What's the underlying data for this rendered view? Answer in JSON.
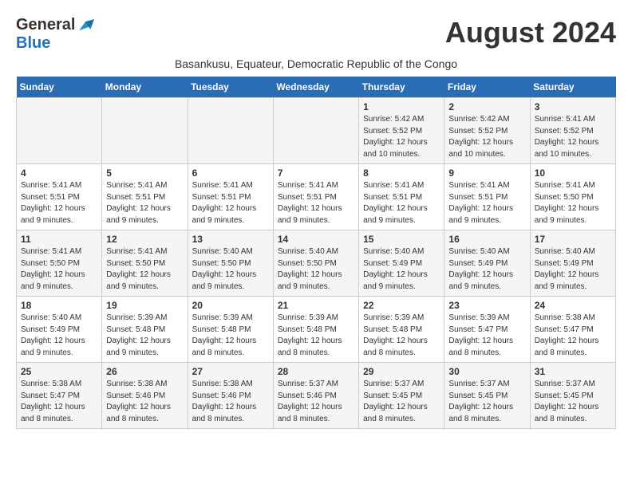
{
  "header": {
    "logo": {
      "general": "General",
      "blue": "Blue"
    },
    "title": "August 2024",
    "subtitle": "Basankusu, Equateur, Democratic Republic of the Congo"
  },
  "calendar": {
    "weekdays": [
      "Sunday",
      "Monday",
      "Tuesday",
      "Wednesday",
      "Thursday",
      "Friday",
      "Saturday"
    ],
    "weeks": [
      [
        {
          "day": "",
          "info": ""
        },
        {
          "day": "",
          "info": ""
        },
        {
          "day": "",
          "info": ""
        },
        {
          "day": "",
          "info": ""
        },
        {
          "day": "1",
          "info": "Sunrise: 5:42 AM\nSunset: 5:52 PM\nDaylight: 12 hours\nand 10 minutes."
        },
        {
          "day": "2",
          "info": "Sunrise: 5:42 AM\nSunset: 5:52 PM\nDaylight: 12 hours\nand 10 minutes."
        },
        {
          "day": "3",
          "info": "Sunrise: 5:41 AM\nSunset: 5:52 PM\nDaylight: 12 hours\nand 10 minutes."
        }
      ],
      [
        {
          "day": "4",
          "info": "Sunrise: 5:41 AM\nSunset: 5:51 PM\nDaylight: 12 hours\nand 9 minutes."
        },
        {
          "day": "5",
          "info": "Sunrise: 5:41 AM\nSunset: 5:51 PM\nDaylight: 12 hours\nand 9 minutes."
        },
        {
          "day": "6",
          "info": "Sunrise: 5:41 AM\nSunset: 5:51 PM\nDaylight: 12 hours\nand 9 minutes."
        },
        {
          "day": "7",
          "info": "Sunrise: 5:41 AM\nSunset: 5:51 PM\nDaylight: 12 hours\nand 9 minutes."
        },
        {
          "day": "8",
          "info": "Sunrise: 5:41 AM\nSunset: 5:51 PM\nDaylight: 12 hours\nand 9 minutes."
        },
        {
          "day": "9",
          "info": "Sunrise: 5:41 AM\nSunset: 5:51 PM\nDaylight: 12 hours\nand 9 minutes."
        },
        {
          "day": "10",
          "info": "Sunrise: 5:41 AM\nSunset: 5:50 PM\nDaylight: 12 hours\nand 9 minutes."
        }
      ],
      [
        {
          "day": "11",
          "info": "Sunrise: 5:41 AM\nSunset: 5:50 PM\nDaylight: 12 hours\nand 9 minutes."
        },
        {
          "day": "12",
          "info": "Sunrise: 5:41 AM\nSunset: 5:50 PM\nDaylight: 12 hours\nand 9 minutes."
        },
        {
          "day": "13",
          "info": "Sunrise: 5:40 AM\nSunset: 5:50 PM\nDaylight: 12 hours\nand 9 minutes."
        },
        {
          "day": "14",
          "info": "Sunrise: 5:40 AM\nSunset: 5:50 PM\nDaylight: 12 hours\nand 9 minutes."
        },
        {
          "day": "15",
          "info": "Sunrise: 5:40 AM\nSunset: 5:49 PM\nDaylight: 12 hours\nand 9 minutes."
        },
        {
          "day": "16",
          "info": "Sunrise: 5:40 AM\nSunset: 5:49 PM\nDaylight: 12 hours\nand 9 minutes."
        },
        {
          "day": "17",
          "info": "Sunrise: 5:40 AM\nSunset: 5:49 PM\nDaylight: 12 hours\nand 9 minutes."
        }
      ],
      [
        {
          "day": "18",
          "info": "Sunrise: 5:40 AM\nSunset: 5:49 PM\nDaylight: 12 hours\nand 9 minutes."
        },
        {
          "day": "19",
          "info": "Sunrise: 5:39 AM\nSunset: 5:48 PM\nDaylight: 12 hours\nand 9 minutes."
        },
        {
          "day": "20",
          "info": "Sunrise: 5:39 AM\nSunset: 5:48 PM\nDaylight: 12 hours\nand 8 minutes."
        },
        {
          "day": "21",
          "info": "Sunrise: 5:39 AM\nSunset: 5:48 PM\nDaylight: 12 hours\nand 8 minutes."
        },
        {
          "day": "22",
          "info": "Sunrise: 5:39 AM\nSunset: 5:48 PM\nDaylight: 12 hours\nand 8 minutes."
        },
        {
          "day": "23",
          "info": "Sunrise: 5:39 AM\nSunset: 5:47 PM\nDaylight: 12 hours\nand 8 minutes."
        },
        {
          "day": "24",
          "info": "Sunrise: 5:38 AM\nSunset: 5:47 PM\nDaylight: 12 hours\nand 8 minutes."
        }
      ],
      [
        {
          "day": "25",
          "info": "Sunrise: 5:38 AM\nSunset: 5:47 PM\nDaylight: 12 hours\nand 8 minutes."
        },
        {
          "day": "26",
          "info": "Sunrise: 5:38 AM\nSunset: 5:46 PM\nDaylight: 12 hours\nand 8 minutes."
        },
        {
          "day": "27",
          "info": "Sunrise: 5:38 AM\nSunset: 5:46 PM\nDaylight: 12 hours\nand 8 minutes."
        },
        {
          "day": "28",
          "info": "Sunrise: 5:37 AM\nSunset: 5:46 PM\nDaylight: 12 hours\nand 8 minutes."
        },
        {
          "day": "29",
          "info": "Sunrise: 5:37 AM\nSunset: 5:45 PM\nDaylight: 12 hours\nand 8 minutes."
        },
        {
          "day": "30",
          "info": "Sunrise: 5:37 AM\nSunset: 5:45 PM\nDaylight: 12 hours\nand 8 minutes."
        },
        {
          "day": "31",
          "info": "Sunrise: 5:37 AM\nSunset: 5:45 PM\nDaylight: 12 hours\nand 8 minutes."
        }
      ]
    ]
  }
}
